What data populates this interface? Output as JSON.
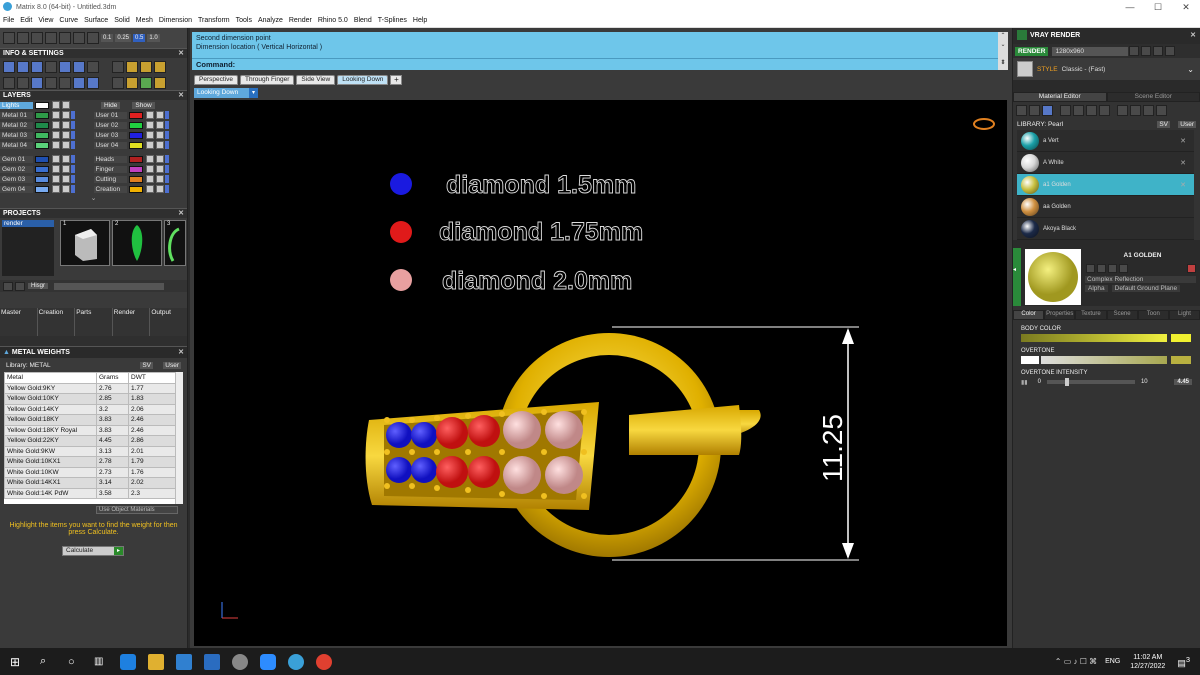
{
  "window": {
    "title": "Matrix 8.0 (64-bit) - Untitled.3dm",
    "min": "—",
    "max": "☐",
    "close": "✕"
  },
  "menu": [
    "File",
    "Edit",
    "View",
    "Curve",
    "Surface",
    "Solid",
    "Mesh",
    "Dimension",
    "Transform",
    "Tools",
    "Analyze",
    "Render",
    "Rhino 5.0",
    "Blend",
    "T-Splines",
    "Help"
  ],
  "left": {
    "toolbar_fields": [
      "0.1",
      "0.25",
      "0.5",
      "1.0"
    ],
    "info_title": "INFO & SETTINGS",
    "layers_title": "LAYERS",
    "layers_header": {
      "left": "Lights",
      "hide": "Hide",
      "show": "Show"
    },
    "layers_left": [
      {
        "name": "Metal 01",
        "color": "#2e9a48"
      },
      {
        "name": "Metal 02",
        "color": "#1f8a4a"
      },
      {
        "name": "Metal 03",
        "color": "#3fb860"
      },
      {
        "name": "Metal 04",
        "color": "#5ad27a"
      },
      {
        "name": "Gem 01",
        "color": "#1f4fb0"
      },
      {
        "name": "Gem 02",
        "color": "#3a6fd0"
      },
      {
        "name": "Gem 03",
        "color": "#5a8de0"
      },
      {
        "name": "Gem 04",
        "color": "#78aaf0"
      }
    ],
    "layers_right": [
      {
        "name": "User 01",
        "color": "#e02020"
      },
      {
        "name": "User 02",
        "color": "#20d040"
      },
      {
        "name": "User 03",
        "color": "#2020e0"
      },
      {
        "name": "User 04",
        "color": "#e0e020"
      },
      {
        "name": "Heads",
        "color": "#b02020"
      },
      {
        "name": "Finger",
        "color": "#c040c0"
      },
      {
        "name": "Cutting",
        "color": "#e08020"
      },
      {
        "name": "Creation",
        "color": "#f0b000"
      }
    ],
    "projects_title": "PROJECTS",
    "project_item": "render",
    "thumbs": [
      "1",
      "2",
      "3"
    ],
    "proj_btn": "Hisgr",
    "mini_tabs": [
      "Master",
      "Creation",
      "Parts",
      "Render",
      "Output"
    ],
    "weights_title": "METAL WEIGHTS",
    "weights_library": "Library: METAL",
    "weights_lib_btns": [
      "SV",
      "User"
    ],
    "weights_cols": [
      "Metal",
      "Grams",
      "DWT"
    ],
    "weights_rows": [
      [
        "Yellow Gold:9KY",
        "2.76",
        "1.77"
      ],
      [
        "Yellow Gold:10KY",
        "2.85",
        "1.83"
      ],
      [
        "Yellow Gold:14KY",
        "3.2",
        "2.06"
      ],
      [
        "Yellow Gold:18KY",
        "3.83",
        "2.46"
      ],
      [
        "Yellow Gold:18KY Royal",
        "3.83",
        "2.46"
      ],
      [
        "Yellow Gold:22KY",
        "4.45",
        "2.86"
      ],
      [
        "White Gold:9KW",
        "3.13",
        "2.01"
      ],
      [
        "White Gold:10KX1",
        "2.78",
        "1.79"
      ],
      [
        "White Gold:10KW",
        "2.73",
        "1.76"
      ],
      [
        "White Gold:14KX1",
        "3.14",
        "2.02"
      ],
      [
        "White Gold:14K PdW",
        "3.58",
        "2.3"
      ]
    ],
    "use_obj": "Use Object Materials",
    "hint": "Highlight the items you want to find the weight for then press Calculate.",
    "calc": "Calculate"
  },
  "command": {
    "line1": "Second dimension point",
    "line2": "Dimension location ( Vertical  Horizontal )",
    "prompt": "Command:"
  },
  "tabs": [
    "Perspective",
    "Through Finger",
    "Side View",
    "Looking Down"
  ],
  "active_tab": "Looking Down",
  "view_select": "Looking Down",
  "legend": [
    {
      "label": "diamond 1.5mm",
      "color": "#1a1ae0"
    },
    {
      "label": "diamond 1.75mm",
      "color": "#e01a1a"
    },
    {
      "label": "diamond 2.0mm",
      "color": "#e8a0a0"
    }
  ],
  "dimension": "11.25",
  "right": {
    "vray_title": "VRAY RENDER",
    "render_btn": "RENDER",
    "resolution": "1280x960",
    "style_label": "STYLE",
    "style_value": "Classic - (Fast)",
    "tabs": [
      "Material Editor",
      "Scene Editor"
    ],
    "library": "LIBRARY: Pearl",
    "lib_btns": [
      "SV",
      "User"
    ],
    "materials": [
      {
        "name": "a Vert",
        "color": "#1aa0a8"
      },
      {
        "name": "A White",
        "color": "#d8d8d8"
      },
      {
        "name": "a1 Golden",
        "color": "#c8c040",
        "selected": true
      },
      {
        "name": "aa Golden",
        "color": "#d09040"
      },
      {
        "name": "Akoya Black",
        "color": "#1c2a48"
      }
    ],
    "selected_name": "A1 GOLDEN",
    "complex": "Complex Reflection",
    "alpha": "Alpha",
    "ground": "Default Ground Plane",
    "subtabs": [
      "Color",
      "Properties",
      "Texture",
      "Scene",
      "Toon",
      "Light"
    ],
    "body_color": "BODY COLOR",
    "overtone": "OVERTONE",
    "overtone_int": "OVERTONE INTENSITY",
    "int_min": "0",
    "int_max": "10",
    "int_val": "4.45"
  },
  "taskbar": {
    "lang": "ENG",
    "time": "11:02 AM",
    "date": "12/27/2022",
    "notif": "3"
  }
}
